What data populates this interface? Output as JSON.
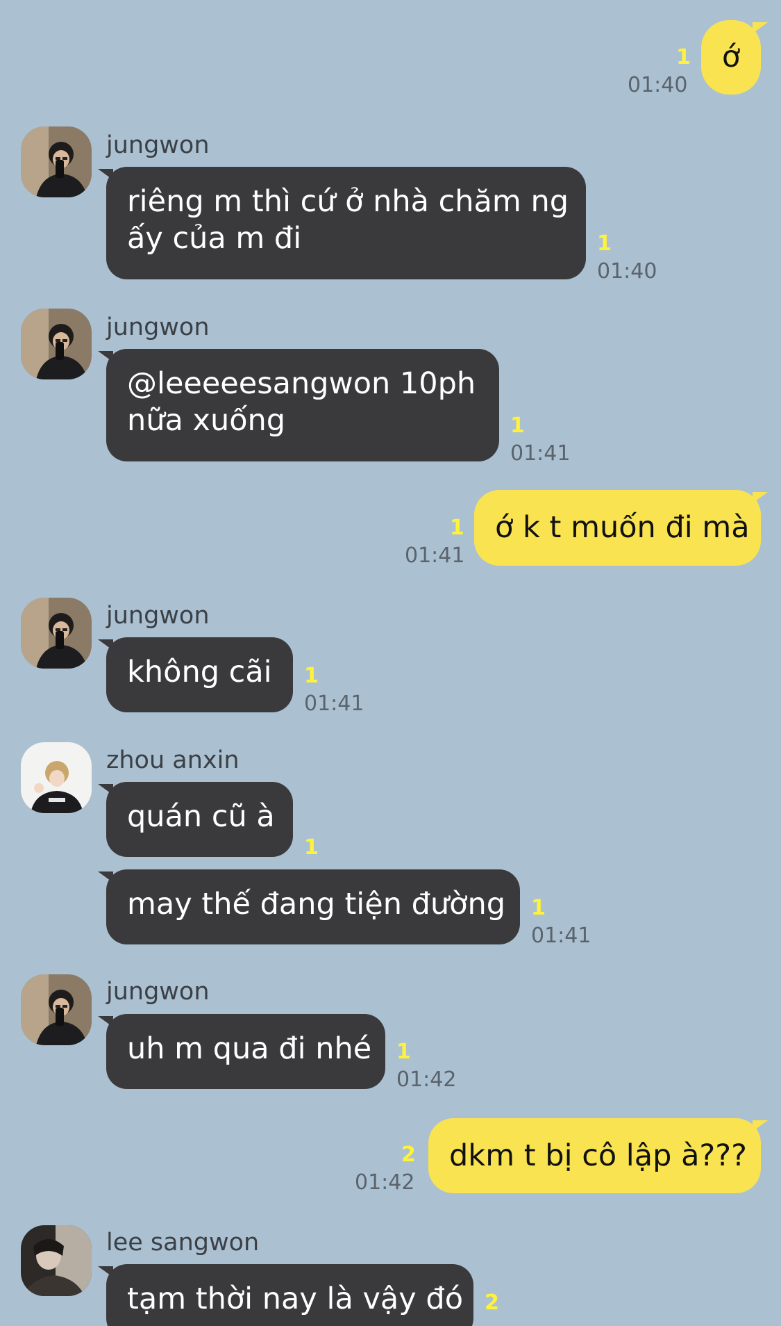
{
  "colors": {
    "background": "#abc1d1",
    "incoming_bubble": "#3a3a3c",
    "outgoing_bubble": "#fae350",
    "unread_count": "#fff23a",
    "timestamp": "#5b636c"
  },
  "messages": [
    {
      "direction": "out",
      "text": "ớ",
      "unread": "1",
      "time": "01:40"
    },
    {
      "direction": "in",
      "sender": "jungwon",
      "avatar": "jungwon-avatar",
      "lines": [
        "riêng m thì cứ ở nhà chăm ng",
        "ấy của m đi"
      ],
      "unread": "1",
      "time": "01:40"
    },
    {
      "direction": "in",
      "sender": "jungwon",
      "avatar": "jungwon-avatar",
      "lines": [
        "@leeeeesangwon 10ph",
        "nữa xuống"
      ],
      "unread": "1",
      "time": "01:41"
    },
    {
      "direction": "out",
      "text": "ớ k t muốn đi mà",
      "unread": "1",
      "time": "01:41"
    },
    {
      "direction": "in",
      "sender": "jungwon",
      "avatar": "jungwon-avatar",
      "text": "không cãi",
      "unread": "1",
      "time": "01:41"
    },
    {
      "direction": "in",
      "sender": "zhou anxin",
      "avatar": "zhou-anxin-avatar",
      "text": "quán cũ à",
      "unread": "1"
    },
    {
      "direction": "in",
      "text": "may thế đang tiện đường",
      "unread": "1",
      "time": "01:41"
    },
    {
      "direction": "in",
      "sender": "jungwon",
      "avatar": "jungwon-avatar",
      "text": "uh m qua đi nhé",
      "unread": "1",
      "time": "01:42"
    },
    {
      "direction": "out",
      "text": "dkm t bị cô lập à???",
      "unread": "2",
      "time": "01:42"
    },
    {
      "direction": "in",
      "sender": "lee sangwon",
      "avatar": "lee-sangwon-avatar",
      "text": "tạm thời nay là vậy đó",
      "unread": "2"
    }
  ]
}
